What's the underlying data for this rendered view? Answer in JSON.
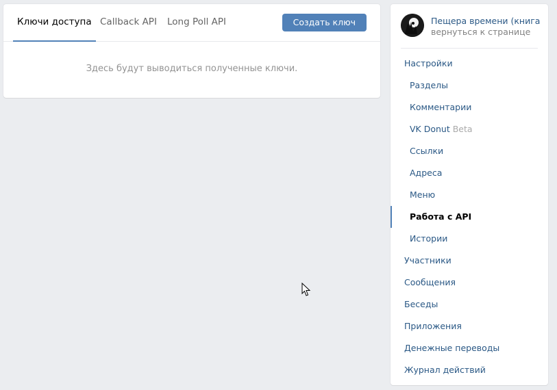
{
  "tabs": [
    {
      "label": "Ключи доступа",
      "active": true
    },
    {
      "label": "Callback API",
      "active": false
    },
    {
      "label": "Long Poll API",
      "active": false
    }
  ],
  "create_key_button": "Создать ключ",
  "empty_message": "Здесь будут выводиться полученные ключи.",
  "sidebar": {
    "group_name": "Пещера времени (книга-...",
    "back_link": "вернуться к странице",
    "items": [
      {
        "label": "Настройки",
        "level": 0
      },
      {
        "label": "Разделы",
        "level": 1
      },
      {
        "label": "Комментарии",
        "level": 1
      },
      {
        "label": "VK Donut",
        "badge": "Beta",
        "level": 1
      },
      {
        "label": "Ссылки",
        "level": 1
      },
      {
        "label": "Адреса",
        "level": 1
      },
      {
        "label": "Меню",
        "level": 1
      },
      {
        "label": "Работа с API",
        "level": 1,
        "active": true
      },
      {
        "label": "Истории",
        "level": 1
      },
      {
        "label": "Участники",
        "level": 0
      },
      {
        "label": "Сообщения",
        "level": 0
      },
      {
        "label": "Беседы",
        "level": 0
      },
      {
        "label": "Приложения",
        "level": 0
      },
      {
        "label": "Денежные переводы",
        "level": 0
      },
      {
        "label": "Журнал действий",
        "level": 0
      }
    ]
  },
  "colors": {
    "accent": "#5181b8",
    "link": "#2a5885",
    "background": "#ebedf0"
  }
}
